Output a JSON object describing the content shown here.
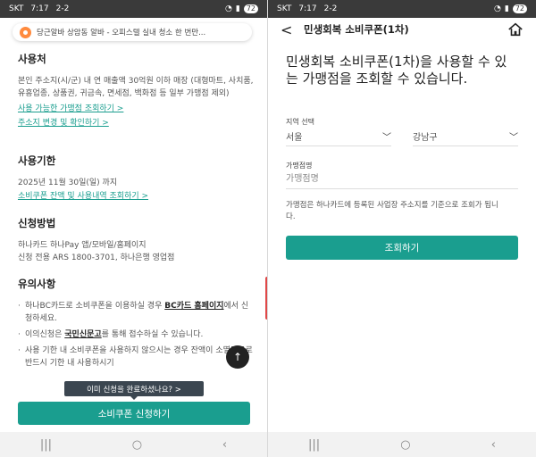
{
  "left": {
    "status": {
      "carrier": "SKT",
      "time": "7:17",
      "mid": "2-2",
      "battery": "72"
    },
    "ad": {
      "text": "당근알바  상암동 알바 - 오피스텔 실내 청소 한 번만..."
    },
    "usage_place": {
      "title": "사용처",
      "body": "본인 주소지(시/군) 내 연 매출액 30억원 이하 매장 (대형마트, 사치품, 유흥업종, 상품권, 귀금속, 면세점, 백화점 등 일부 가맹점 제외)",
      "link1": "사용 가능한 가맹점 조회하기 >",
      "link2": "주소지 변경 및 확인하기 >"
    },
    "period": {
      "title": "사용기한",
      "body": "2025년 11월 30일(일) 까지",
      "link": "소비쿠폰 잔액 및 사용내역 조회하기 >"
    },
    "apply_method": {
      "title": "신청방법",
      "line1": "하나카드 하나Pay 앱/모바일/홈페이지",
      "line2": "신청 전용 ARS 1800-3701, 하나은행 영업점"
    },
    "notice": {
      "title": "유의사항",
      "b1_pre": "하나BC카드로 소비쿠폰을 이용하실 경우 ",
      "b1_link": "BC카드 홈페이지",
      "b1_post": "에서 신청하세요.",
      "b2_pre": "이의신청은 ",
      "b2_link": "국민신문고",
      "b2_post": "를 통해 접수하실 수 있습니다.",
      "b3": "사용 기한 내 소비쿠폰을 사용하지 않으시는 경우 잔액이 소멸되므로 반드시 기한 내 사용하시기"
    },
    "tooltip": "이미 신청을 완료하셨나요?  >",
    "apply_button": "소비쿠폰 신청하기",
    "fab_icon": "arrow-up-icon"
  },
  "right": {
    "status": {
      "carrier": "SKT",
      "time": "7:17",
      "mid": "2-2",
      "battery": "72"
    },
    "header": {
      "back": "<",
      "title": "민생회복 소비쿠폰(1차)"
    },
    "headline": "민생회복 소비쿠폰(1차)을 사용할 수 있는 가맹점을 조회할 수 있습니다.",
    "region": {
      "label": "지역 선택",
      "city": "서울",
      "district": "강남구"
    },
    "merchant": {
      "label": "가맹점명",
      "placeholder": "가맹점명"
    },
    "note": "가맹점은 하나카드에 등록된 사업장 주소지를 기준으로 조회가 됩니다.",
    "search_button": "조회하기"
  },
  "colors": {
    "accent": "#1a9e8f",
    "scroll_indicator": "#e04848",
    "tooltip_bg": "#3b4650"
  }
}
